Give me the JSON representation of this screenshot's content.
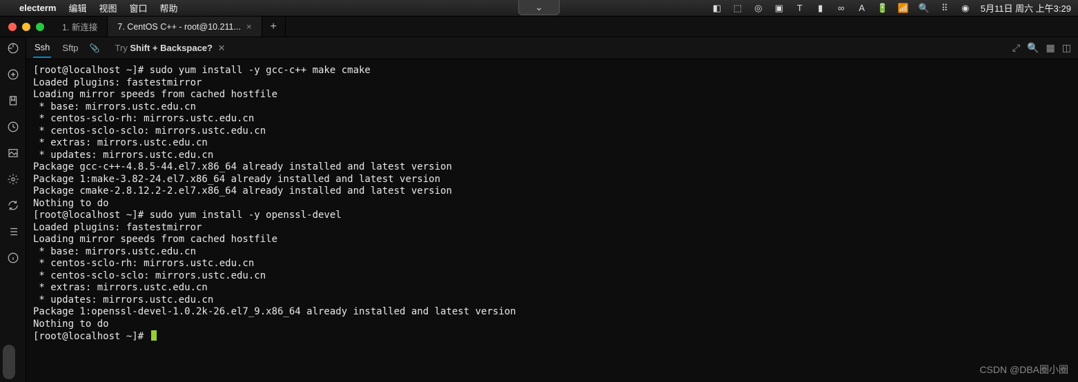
{
  "menubar": {
    "apple": "",
    "app": "electerm",
    "items": [
      "编辑",
      "视图",
      "窗口",
      "帮助"
    ],
    "status": {
      "date": "5月11日 周六 上午3:29"
    }
  },
  "notch_glyph": "⌄",
  "window": {
    "tabs": [
      {
        "label": "1. 新连接",
        "active": false
      },
      {
        "label": "7. CentOS C++ - root@10.211...",
        "active": true
      }
    ],
    "add_glyph": "+"
  },
  "subbar": {
    "ssh": "Ssh",
    "sftp": "Sftp",
    "hint_pre": "Try ",
    "hint_key": "Shift + Backspace?",
    "hint_close": "✕"
  },
  "terminal_lines": [
    "[root@localhost ~]# sudo yum install -y gcc-c++ make cmake",
    "Loaded plugins: fastestmirror",
    "Loading mirror speeds from cached hostfile",
    " * base: mirrors.ustc.edu.cn",
    " * centos-sclo-rh: mirrors.ustc.edu.cn",
    " * centos-sclo-sclo: mirrors.ustc.edu.cn",
    " * extras: mirrors.ustc.edu.cn",
    " * updates: mirrors.ustc.edu.cn",
    "Package gcc-c++-4.8.5-44.el7.x86_64 already installed and latest version",
    "Package 1:make-3.82-24.el7.x86_64 already installed and latest version",
    "Package cmake-2.8.12.2-2.el7.x86_64 already installed and latest version",
    "Nothing to do",
    "[root@localhost ~]# sudo yum install -y openssl-devel",
    "Loaded plugins: fastestmirror",
    "Loading mirror speeds from cached hostfile",
    " * base: mirrors.ustc.edu.cn",
    " * centos-sclo-rh: mirrors.ustc.edu.cn",
    " * centos-sclo-sclo: mirrors.ustc.edu.cn",
    " * extras: mirrors.ustc.edu.cn",
    " * updates: mirrors.ustc.edu.cn",
    "Package 1:openssl-devel-1.0.2k-26.el7_9.x86_64 already installed and latest version",
    "Nothing to do",
    "[root@localhost ~]# "
  ],
  "watermark": "CSDN @DBA圈小圈"
}
